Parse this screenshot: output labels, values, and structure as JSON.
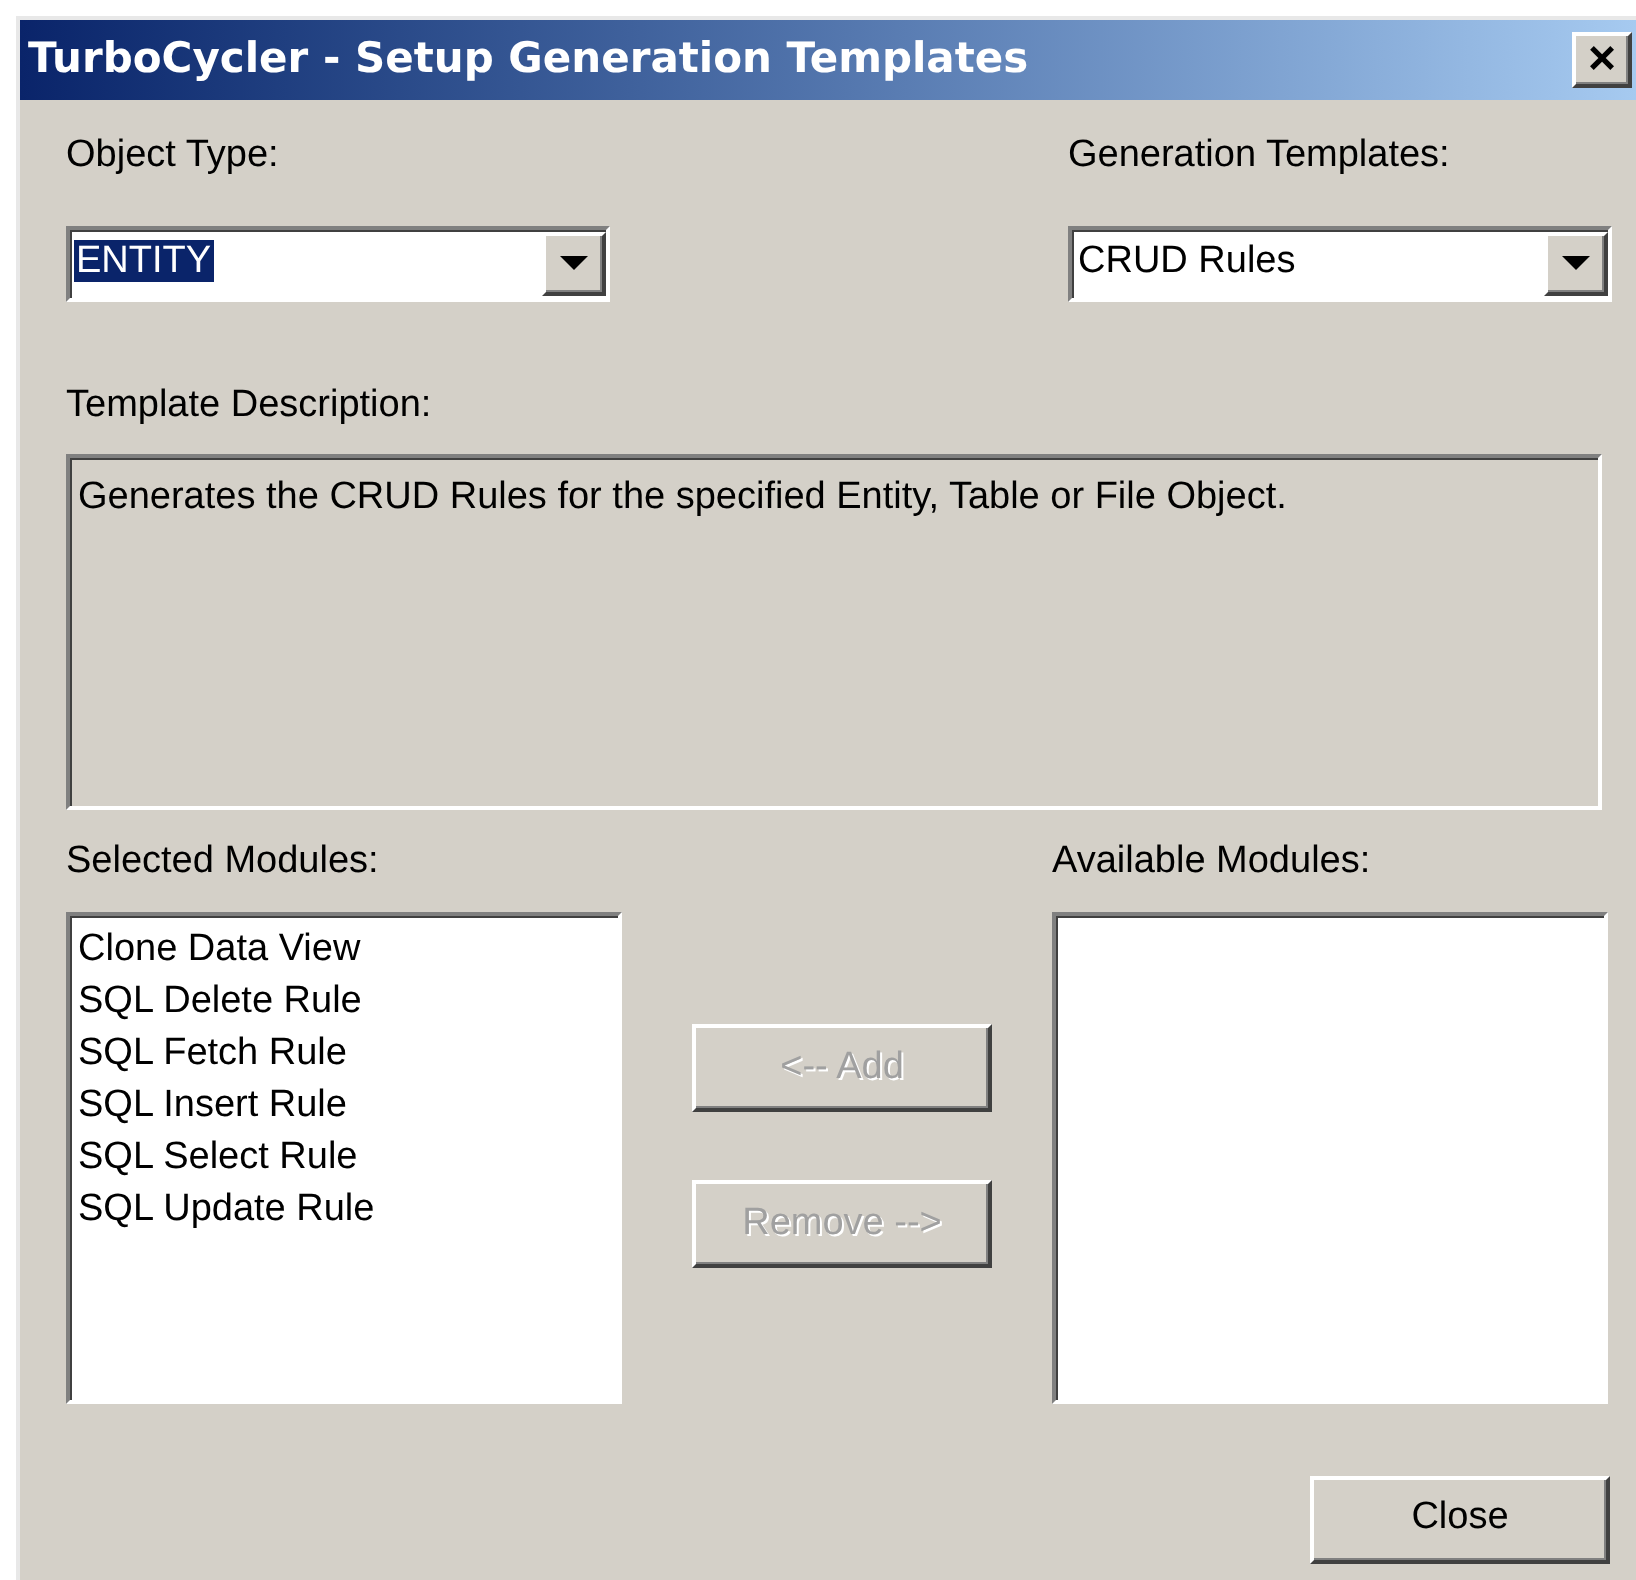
{
  "window": {
    "title": "TurboCycler - Setup Generation Templates",
    "close": "×"
  },
  "object_type": {
    "label": "Object Type:",
    "value": "ENTITY",
    "text_selected": true
  },
  "generation_templates": {
    "label": "Generation Templates:",
    "value": "CRUD Rules",
    "text_selected": false
  },
  "template_description": {
    "label": "Template Description:",
    "value": "Generates the CRUD Rules for the specified Entity, Table or File Object."
  },
  "selected_modules": {
    "label": "Selected Modules:",
    "items": [
      {
        "label": "Clone Data View",
        "selected": false
      },
      {
        "label": "SQL Delete Rule",
        "selected": false
      },
      {
        "label": "SQL Fetch Rule",
        "selected": false
      },
      {
        "label": "SQL Insert Rule",
        "selected": false
      },
      {
        "label": "SQL Select Rule",
        "selected": false
      },
      {
        "label": "SQL Update Rule",
        "selected": false
      }
    ]
  },
  "available_modules": {
    "label": "Available Modules:"
  },
  "buttons": [
    {
      "label": "<-- Add",
      "disabled": true
    },
    {
      "label": "Remove -->",
      "disabled": true
    },
    {
      "label": "Close",
      "disabled": false
    }
  ]
}
